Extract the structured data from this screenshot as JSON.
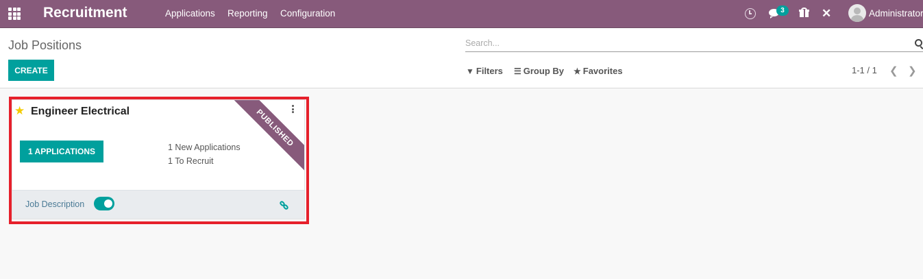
{
  "navbar": {
    "app_name": "Recruitment",
    "menu": [
      "Applications",
      "Reporting",
      "Configuration"
    ],
    "chat_badge": "3",
    "user_name": "Administrator",
    "icons": [
      "apps-grid-icon",
      "clock-icon",
      "chat-icon",
      "gift-icon",
      "tools-icon"
    ],
    "color": "#875a7b"
  },
  "control_panel": {
    "title": "Job Positions",
    "create_label": "CREATE",
    "search_placeholder": "Search...",
    "filters_label": "Filters",
    "groupby_label": "Group By",
    "favorites_label": "Favorites",
    "pager_text": "1-1 / 1"
  },
  "card": {
    "title": "Engineer Electrical",
    "ribbon": "PUBLISHED",
    "applications_button": "1 APPLICATIONS",
    "new_applications": "1 New Applications",
    "to_recruit": "1 To Recruit",
    "job_description_label": "Job Description",
    "job_description_enabled": true,
    "accent_color": "#00a09d"
  }
}
